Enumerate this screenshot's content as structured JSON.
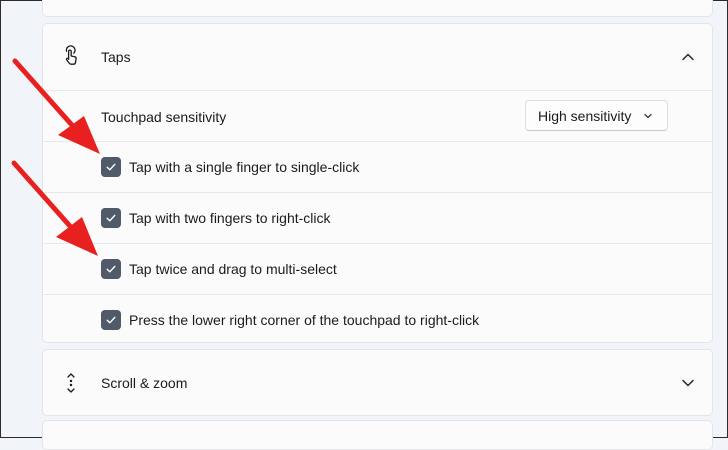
{
  "taps": {
    "title": "Taps",
    "icon": "tap-gesture-icon",
    "expanded": true,
    "sensitivity_label": "Touchpad sensitivity",
    "sensitivity_value": "High sensitivity",
    "options": [
      {
        "label": "Tap with a single finger to single-click",
        "checked": true
      },
      {
        "label": "Tap with two fingers to right-click",
        "checked": true
      },
      {
        "label": "Tap twice and drag to multi-select",
        "checked": true
      },
      {
        "label": "Press the lower right corner of the touchpad to right-click",
        "checked": true
      }
    ]
  },
  "scroll_zoom": {
    "title": "Scroll & zoom",
    "icon": "scroll-arrows-icon",
    "expanded": false
  },
  "colors": {
    "checkbox_fill": "#505a68",
    "annotation_arrow": "#e8201f",
    "page_background": "#f1f4f8",
    "card_background": "#fbfbfb"
  }
}
